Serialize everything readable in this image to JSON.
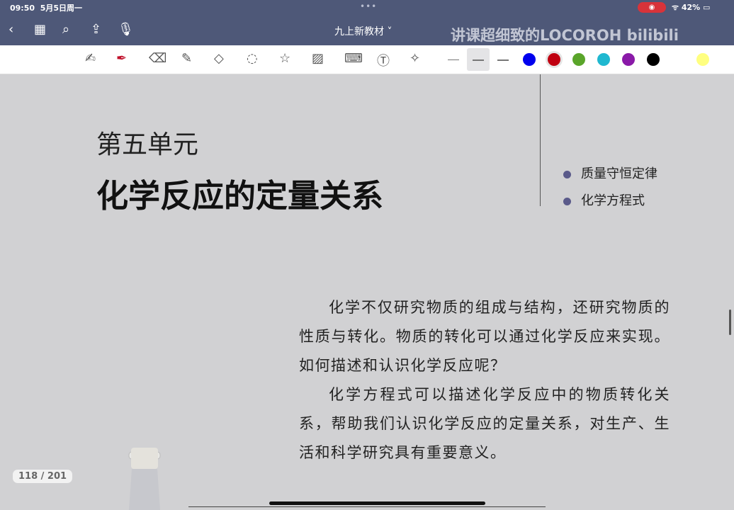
{
  "status": {
    "time": "09:50",
    "date": "5月5日周一",
    "battery": "42%"
  },
  "nav": {
    "doc_title": "九上新教材",
    "watermark": "讲课超细致的LOCOROH bilibili"
  },
  "tools": [
    "zoom-write",
    "pen",
    "eraser",
    "highlighter",
    "shapes",
    "lasso",
    "sticker",
    "image",
    "keyboard",
    "text",
    "laser"
  ],
  "colors": [
    "#0000ee",
    "#c00010",
    "#5aa52a",
    "#1fb8d0",
    "#8a1aa8",
    "#000000",
    "#ffffff",
    "#ffff80"
  ],
  "page": {
    "unit": "第五单元",
    "title": "化学反应的定量关系",
    "topics": [
      "质量守恒定律",
      "化学方程式"
    ],
    "paragraphs": [
      "化学不仅研究物质的组成与结构，还研究物质的性质与转化。物质的转化可以通过化学反应来实现。如何描述和认识化学反应呢？",
      "化学方程式可以描述化学反应中的物质转化关系，帮助我们认识化学反应的定量关系，对生产、生活和科学研究具有重要意义。"
    ]
  },
  "page_indicator": "118 / 201"
}
